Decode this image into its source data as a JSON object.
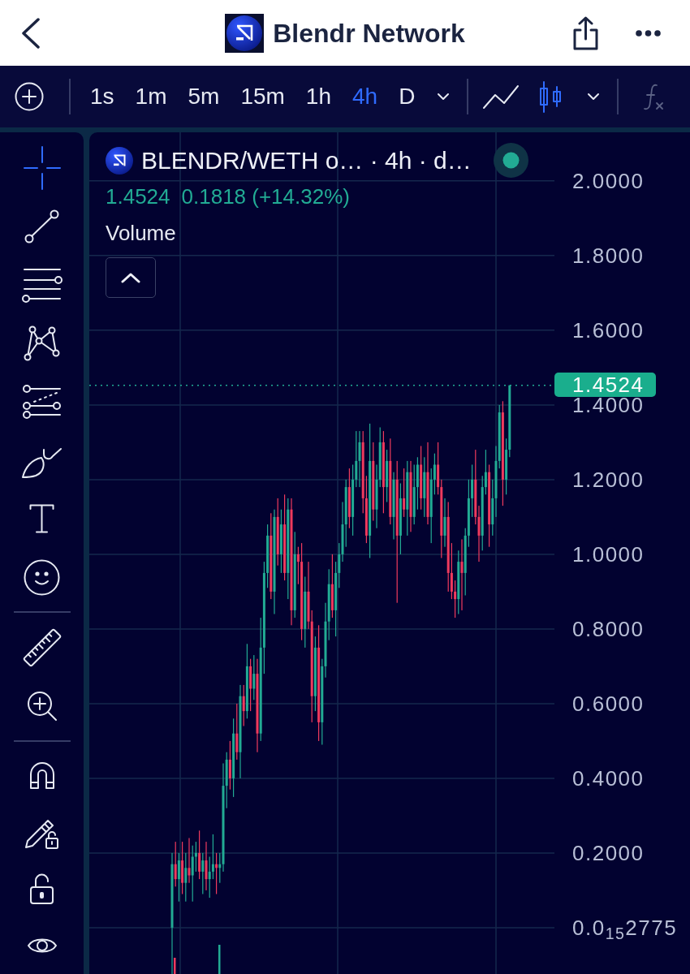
{
  "app_bar": {
    "title": "Blendr Network"
  },
  "toolbar": {
    "timeframes": [
      {
        "label": "1s",
        "selected": false
      },
      {
        "label": "1m",
        "selected": false
      },
      {
        "label": "5m",
        "selected": false
      },
      {
        "label": "15m",
        "selected": false
      },
      {
        "label": "1h",
        "selected": false
      },
      {
        "label": "4h",
        "selected": true
      },
      {
        "label": "D",
        "selected": false
      }
    ],
    "chart_types": [
      {
        "kind": "line",
        "selected": false
      },
      {
        "kind": "candles",
        "selected": true
      }
    ]
  },
  "drawing_tools": {
    "groups": [
      {
        "tools": [
          {
            "kind": "crosshair",
            "selected": true
          },
          {
            "kind": "trend_line",
            "selected": false
          },
          {
            "kind": "horizontal_lines",
            "selected": false
          },
          {
            "kind": "pattern",
            "selected": false
          },
          {
            "kind": "fibonacci",
            "selected": false
          },
          {
            "kind": "brush",
            "selected": false
          },
          {
            "kind": "text",
            "selected": false
          },
          {
            "kind": "emoji",
            "selected": false
          }
        ]
      },
      {
        "tools": [
          {
            "kind": "ruler",
            "selected": false
          },
          {
            "kind": "zoom_in",
            "selected": false
          }
        ]
      },
      {
        "tools": [
          {
            "kind": "magnet",
            "selected": false
          },
          {
            "kind": "lock_drawings",
            "selected": false
          },
          {
            "kind": "lock",
            "selected": false
          },
          {
            "kind": "visibility",
            "selected": false
          }
        ]
      }
    ]
  },
  "legend": {
    "symbol": "BLENDR/WETH o… · 4h · d…",
    "live": true,
    "last": "1.4524",
    "change": "0.1818 (+14.32%)",
    "indicator": "Volume"
  },
  "chart": {
    "current_price": "1.4524",
    "chart_data": {
      "type": "candlestick",
      "grid": true,
      "ylim": [
        -0.124,
        2.13
      ],
      "yticks": [
        {
          "value": 2,
          "label": "2.0000"
        },
        {
          "value": 1.8,
          "label": "1.8000"
        },
        {
          "value": 1.6,
          "label": "1.6000"
        },
        {
          "value": 1.4,
          "label": "1.4000"
        },
        {
          "value": 1.2,
          "label": "1.2000"
        },
        {
          "value": 1,
          "label": "1.0000"
        },
        {
          "value": 0.8,
          "label": "0.8000"
        },
        {
          "value": 0.6,
          "label": "0.6000"
        },
        {
          "value": 0.4,
          "label": "0.4000"
        },
        {
          "value": 0.2,
          "label": "0.2000"
        },
        {
          "value": 2.775e-16,
          "label": "0.0$_{15}$2775"
        }
      ],
      "ohlc": [
        [
          0,
          0.2,
          -0.13,
          0.17
        ],
        [
          0.17,
          0.23,
          0.11,
          0.13
        ],
        [
          0.13,
          0.2,
          0.07,
          0.18
        ],
        [
          0.18,
          0.23,
          0.09,
          0.12
        ],
        [
          0.12,
          0.2,
          0.07,
          0.16
        ],
        [
          0.16,
          0.24,
          0.12,
          0.14
        ],
        [
          0.14,
          0.22,
          0.07,
          0.19
        ],
        [
          0.19,
          0.23,
          0.15,
          0.2
        ],
        [
          0.2,
          0.26,
          0.13,
          0.15
        ],
        [
          0.15,
          0.2,
          0.09,
          0.18
        ],
        [
          0.18,
          0.23,
          0.1,
          0.13
        ],
        [
          0.13,
          0.19,
          0.08,
          0.15
        ],
        [
          0.15,
          0.25,
          0.13,
          0.17
        ],
        [
          0.17,
          0.2,
          0.09,
          0.16
        ],
        [
          0.16,
          0.2,
          0.12,
          0.17
        ],
        [
          0.17,
          0.44,
          0.15,
          0.38
        ],
        [
          0.38,
          0.47,
          0.32,
          0.45
        ],
        [
          0.45,
          0.5,
          0.37,
          0.4
        ],
        [
          0.4,
          0.56,
          0.35,
          0.52
        ],
        [
          0.52,
          0.6,
          0.45,
          0.47
        ],
        [
          0.47,
          0.65,
          0.4,
          0.62
        ],
        [
          0.62,
          0.65,
          0.54,
          0.58
        ],
        [
          0.58,
          0.76,
          0.56,
          0.7
        ],
        [
          0.7,
          0.72,
          0.58,
          0.64
        ],
        [
          0.64,
          0.73,
          0.61,
          0.68
        ],
        [
          0.68,
          0.72,
          0.47,
          0.52
        ],
        [
          0.52,
          0.83,
          0.5,
          0.75
        ],
        [
          0.75,
          0.98,
          0.68,
          0.95
        ],
        [
          0.95,
          1.08,
          0.91,
          1.05
        ],
        [
          1.05,
          1.11,
          0.88,
          0.9
        ],
        [
          0.9,
          1.12,
          0.84,
          1.1
        ],
        [
          1.1,
          1.15,
          0.97,
          1
        ],
        [
          1,
          1.12,
          0.95,
          1.08
        ],
        [
          1.08,
          1.16,
          0.93,
          0.95
        ],
        [
          0.95,
          1.15,
          0.88,
          1.12
        ],
        [
          1.12,
          1.15,
          0.81,
          0.85
        ],
        [
          0.85,
          1.06,
          0.83,
          1
        ],
        [
          1,
          1.02,
          0.92,
          0.98
        ],
        [
          0.98,
          1.03,
          0.77,
          0.8
        ],
        [
          0.8,
          0.94,
          0.75,
          0.9
        ],
        [
          0.9,
          0.98,
          0.8,
          0.82
        ],
        [
          0.82,
          0.85,
          0.55,
          0.62
        ],
        [
          0.62,
          0.78,
          0.58,
          0.75
        ],
        [
          0.75,
          0.81,
          0.5,
          0.55
        ],
        [
          0.55,
          0.72,
          0.49,
          0.7
        ],
        [
          0.7,
          0.87,
          0.67,
          0.82
        ],
        [
          0.82,
          0.96,
          0.77,
          0.92
        ],
        [
          0.92,
          1,
          0.83,
          0.85
        ],
        [
          0.85,
          0.98,
          0.78,
          0.95
        ],
        [
          0.95,
          1.03,
          0.91,
          1
        ],
        [
          1,
          1.14,
          0.98,
          1.08
        ],
        [
          1.08,
          1.2,
          1.02,
          1.18
        ],
        [
          1.18,
          1.23,
          1.07,
          1.1
        ],
        [
          1.1,
          1.24,
          1.05,
          1.2
        ],
        [
          1.2,
          1.33,
          1.18,
          1.25
        ],
        [
          1.25,
          1.33,
          1.18,
          1.3
        ],
        [
          1.3,
          1.33,
          1.11,
          1.15
        ],
        [
          1.15,
          1.21,
          1.03,
          1.05
        ],
        [
          1.05,
          1.35,
          0.99,
          1.25
        ],
        [
          1.25,
          1.3,
          1.09,
          1.12
        ],
        [
          1.12,
          1.24,
          1.07,
          1.2
        ],
        [
          1.2,
          1.34,
          1.18,
          1.3
        ],
        [
          1.3,
          1.33,
          1.11,
          1.18
        ],
        [
          1.18,
          1.28,
          1.14,
          1.25
        ],
        [
          1.25,
          1.31,
          1.08,
          1.1
        ],
        [
          1.1,
          1.22,
          1.04,
          1.2
        ],
        [
          1.2,
          1.25,
          0.87,
          1.05
        ],
        [
          1.05,
          1.19,
          1,
          1.15
        ],
        [
          1.15,
          1.23,
          1.1,
          1.12
        ],
        [
          1.12,
          1.25,
          1.05,
          1.22
        ],
        [
          1.22,
          1.25,
          1.06,
          1.1
        ],
        [
          1.1,
          1.24,
          1.08,
          1.18
        ],
        [
          1.18,
          1.26,
          1.12,
          1.24
        ],
        [
          1.24,
          1.29,
          1.12,
          1.15
        ],
        [
          1.15,
          1.26,
          1.1,
          1.22
        ],
        [
          1.22,
          1.3,
          1.08,
          1.1
        ],
        [
          1.1,
          1.23,
          1.03,
          1.2
        ],
        [
          1.2,
          1.27,
          1.16,
          1.24
        ],
        [
          1.24,
          1.3,
          1.16,
          1.18
        ],
        [
          1.18,
          1.2,
          0.99,
          1.05
        ],
        [
          1.05,
          1.15,
          1.02,
          1.1
        ],
        [
          1.1,
          1.14,
          0.9,
          0.95
        ],
        [
          0.95,
          1.03,
          0.88,
          0.9
        ],
        [
          0.9,
          0.93,
          0.83,
          0.88
        ],
        [
          0.88,
          1.01,
          0.84,
          0.98
        ],
        [
          0.98,
          1.04,
          0.85,
          0.95
        ],
        [
          0.95,
          1.07,
          0.89,
          1.05
        ],
        [
          1.05,
          1.2,
          1.02,
          1.15
        ],
        [
          1.15,
          1.24,
          1.1,
          1.2
        ],
        [
          1.2,
          1.28,
          1.08,
          1.1
        ],
        [
          1.1,
          1.13,
          0.98,
          1.05
        ],
        [
          1.05,
          1.21,
          1.01,
          1.18
        ],
        [
          1.18,
          1.28,
          1.16,
          1.22
        ],
        [
          1.22,
          1.24,
          1.02,
          1.08
        ],
        [
          1.08,
          1.2,
          1.05,
          1.15
        ],
        [
          1.15,
          1.29,
          1.1,
          1.25
        ],
        [
          1.25,
          1.4,
          1.23,
          1.38
        ],
        [
          1.38,
          1.41,
          1.13,
          1.2
        ],
        [
          1.2,
          1.31,
          1.16,
          1.28
        ],
        [
          1.28,
          1.4524,
          1.26,
          1.4524
        ]
      ]
    }
  }
}
